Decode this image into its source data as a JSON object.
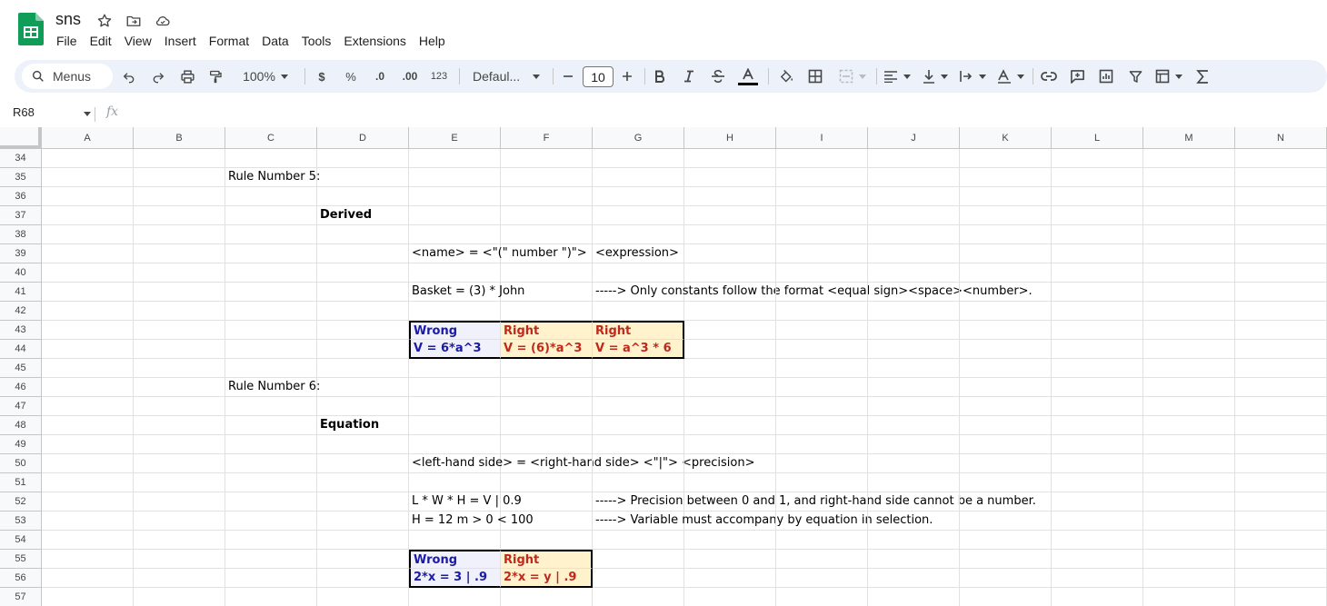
{
  "app": {
    "doc_title": "sns",
    "menus": [
      "File",
      "Edit",
      "View",
      "Insert",
      "Format",
      "Data",
      "Tools",
      "Extensions",
      "Help"
    ]
  },
  "toolbar": {
    "search_label": "Menus",
    "zoom": "100%",
    "currency": "$",
    "percent": "%",
    "decrease_decimal": ".0",
    "increase_decimal": ".00",
    "number_format": "123",
    "font": "Defaul...",
    "font_size": "10",
    "accent_color": "#edf2fa"
  },
  "formula_bar": {
    "name_box": "R68",
    "fx": "fx"
  },
  "columns": [
    "A",
    "B",
    "C",
    "D",
    "E",
    "F",
    "G",
    "H",
    "I",
    "J",
    "K",
    "L",
    "M",
    "N"
  ],
  "rows": [
    {
      "num": "34",
      "cells": {}
    },
    {
      "num": "35",
      "cells": {
        "C": "Rule Number 5:"
      }
    },
    {
      "num": "36",
      "cells": {}
    },
    {
      "num": "37",
      "cells": {
        "D": "Derived"
      }
    },
    {
      "num": "38",
      "cells": {}
    },
    {
      "num": "39",
      "cells": {
        "E": "<name> = <\"(\" number \")\">",
        "G": "<expression>"
      }
    },
    {
      "num": "40",
      "cells": {}
    },
    {
      "num": "41",
      "cells": {
        "E": "Basket = (3) * John",
        "G": "-----> Only constants follow the format <equal sign><space><number>."
      }
    },
    {
      "num": "42",
      "cells": {}
    },
    {
      "num": "43",
      "cells": {
        "E": "Wrong",
        "F": "Right",
        "G": "Right"
      }
    },
    {
      "num": "44",
      "cells": {
        "E": "V = 6*a^3",
        "F": "V = (6)*a^3",
        "G": "V = a^3 * 6"
      }
    },
    {
      "num": "45",
      "cells": {}
    },
    {
      "num": "46",
      "cells": {
        "C": "Rule Number 6:"
      }
    },
    {
      "num": "47",
      "cells": {}
    },
    {
      "num": "48",
      "cells": {
        "D": "Equation"
      }
    },
    {
      "num": "49",
      "cells": {}
    },
    {
      "num": "50",
      "cells": {
        "E": "<left-hand side> = <right-hand side> <\"|\"> <precision>"
      }
    },
    {
      "num": "51",
      "cells": {}
    },
    {
      "num": "52",
      "cells": {
        "E": "L * W * H = V | 0.9",
        "G": "-----> Precision between 0 and 1, and right-hand side cannot be a number."
      }
    },
    {
      "num": "53",
      "cells": {
        "E": "H = 12 m > 0 < 100",
        "G": "-----> Variable must accompany by equation in selection."
      }
    },
    {
      "num": "54",
      "cells": {}
    },
    {
      "num": "55",
      "cells": {
        "E": "Wrong",
        "F": "Right"
      }
    },
    {
      "num": "56",
      "cells": {
        "E": "2*x = 3 | .9",
        "F": "2*x = y | .9"
      }
    },
    {
      "num": "57",
      "cells": {}
    }
  ],
  "colors": {
    "wrong_text": "#1a1aa6",
    "wrong_bg": "#f1f1fb",
    "right_text": "#c0281c",
    "right_bg": "#fff2cc"
  }
}
